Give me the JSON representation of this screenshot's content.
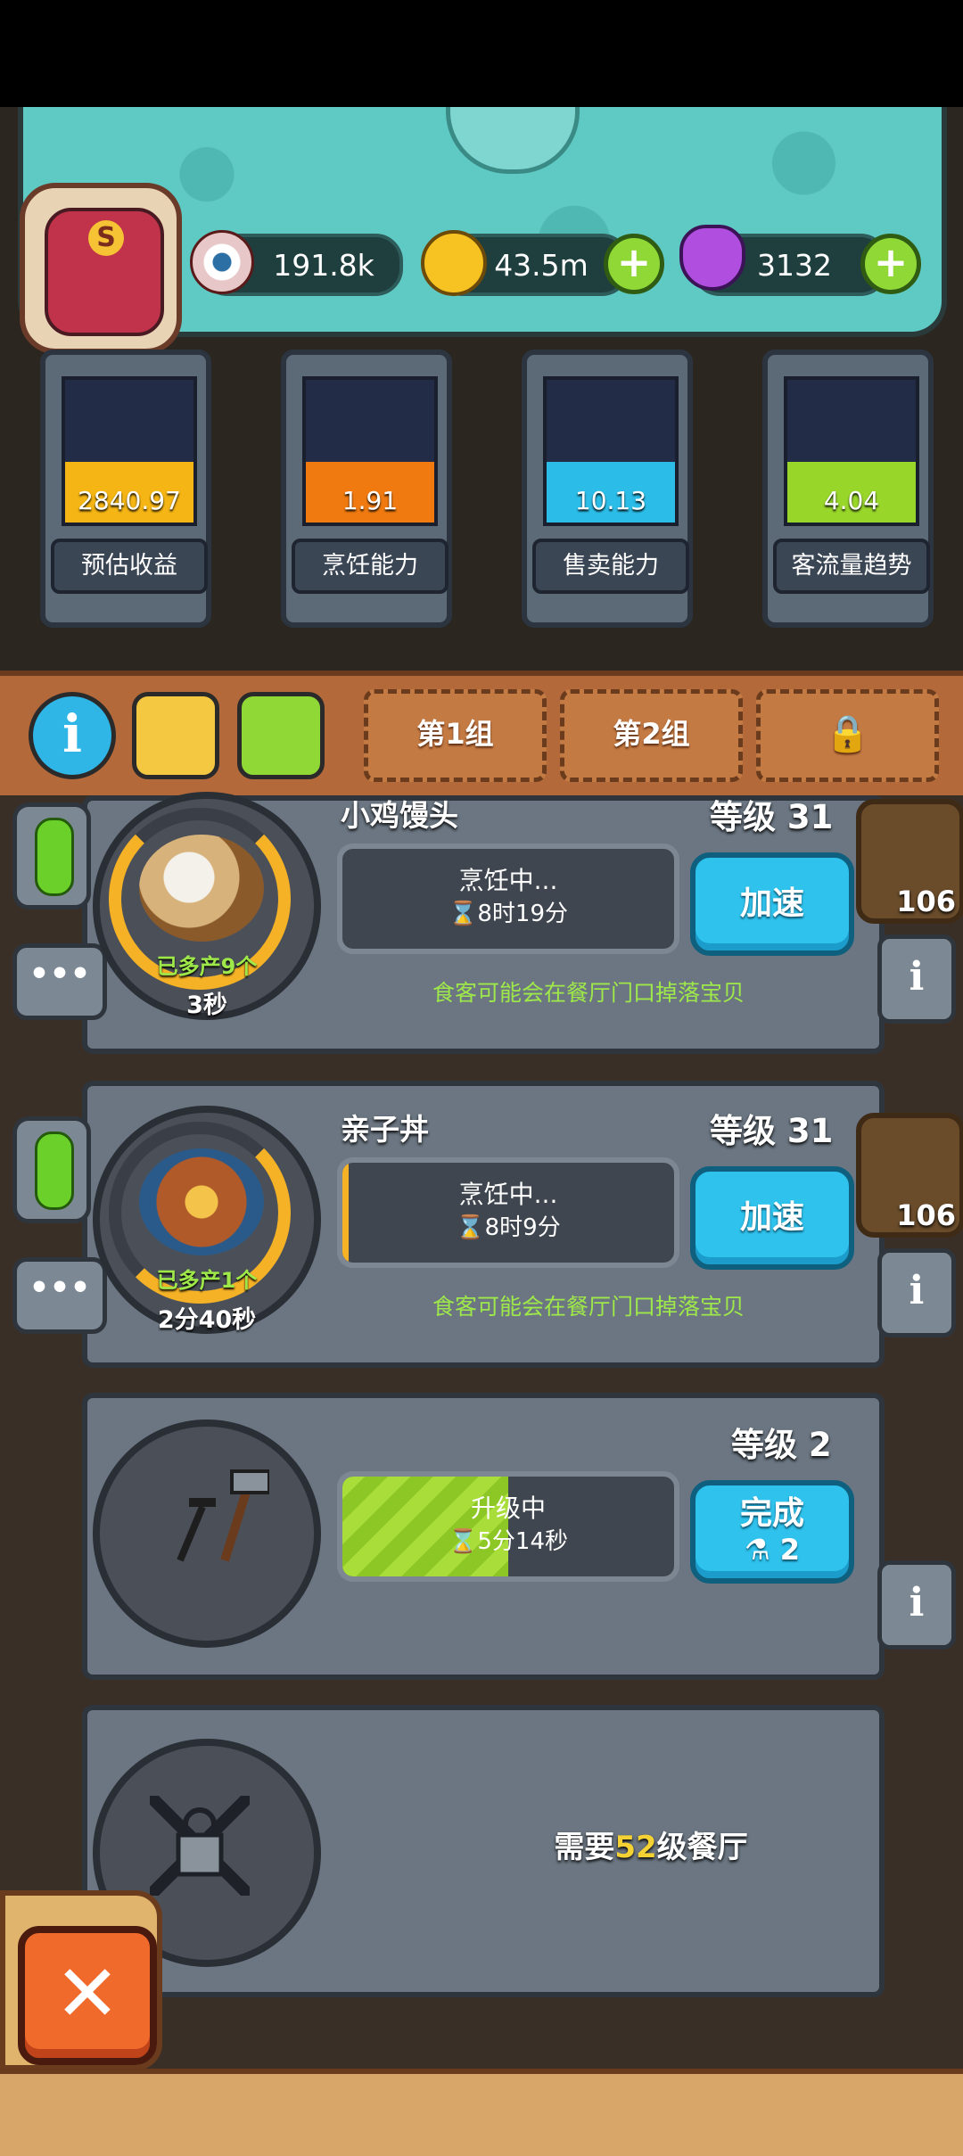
{
  "resources": {
    "eyes": "191.8k",
    "coins": "43.5m",
    "potions": "3132"
  },
  "stats": [
    {
      "value": "2840.97",
      "label": "预估收益",
      "color": "#f5b514"
    },
    {
      "value": "1.91",
      "label": "烹饪能力",
      "color": "#f07a10"
    },
    {
      "value": "10.13",
      "label": "售卖能力",
      "color": "#2bbde8"
    },
    {
      "value": "4.04",
      "label": "客流量趋势",
      "color": "#98d62a"
    }
  ],
  "groups": {
    "group1": "第1组",
    "group2": "第2组"
  },
  "kitchens": [
    {
      "name": "小鸡馒头",
      "level": "等级 31",
      "status": "烹饪中...",
      "time": "8时19分",
      "button": "加速",
      "extra": "已多产9个",
      "cycle": "3秒",
      "hint": "食客可能会在餐厅门口掉落宝贝",
      "thumb_count": "106",
      "progress": 0.0
    },
    {
      "name": "亲子丼",
      "level": "等级 31",
      "status": "烹饪中...",
      "time": "8时9分",
      "button": "加速",
      "extra": "已多产1个",
      "cycle": "2分40秒",
      "hint": "食客可能会在餐厅门口掉落宝贝",
      "thumb_count": "106",
      "progress": 0.02
    }
  ],
  "upgrade": {
    "level": "等级 2",
    "status": "升级中",
    "time": "5分14秒",
    "button": "完成",
    "cost": "2",
    "progress": 0.5
  },
  "locked": {
    "prefix": "需要",
    "number": "52",
    "suffix": "级餐厅"
  },
  "colors": {
    "accent_blue": "#2fc2ec",
    "accent_green": "#98d62a",
    "gold": "#f5b226"
  }
}
